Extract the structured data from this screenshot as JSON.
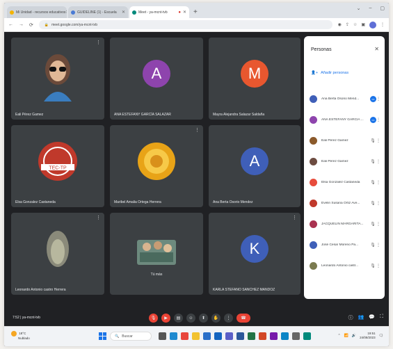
{
  "browser": {
    "tabs": [
      {
        "label": "Mi Unidad - recursos educativos",
        "active": false
      },
      {
        "label": "GUIDELINE (1) - Escuela",
        "active": false
      },
      {
        "label": "Meet - ya-mcnt-tvb",
        "active": true
      }
    ],
    "url": "meet.google.com/ya-mcnt-tvb"
  },
  "tiles": [
    {
      "name": "Eali Pérez Gamez",
      "kind": "photo",
      "photo": "woman-sunglasses"
    },
    {
      "name": "ANA ESTEFANY GARCÍA SALAZAR",
      "kind": "avatar",
      "letter": "A",
      "color": "#8e44ad"
    },
    {
      "name": "Mayra Alejandra Salazar Saldaña",
      "kind": "avatar",
      "letter": "M",
      "color": "#e8572f"
    },
    {
      "name": "Elsa Gonzalez Castaneda",
      "kind": "photo",
      "photo": "tec-logo"
    },
    {
      "name": "Maribel Amalia Ortega Herrera",
      "kind": "photo",
      "photo": "yellow-flower"
    },
    {
      "name": "Ana Berta Osorio Mendez",
      "kind": "avatar",
      "letter": "A",
      "color": "#3f5fb8"
    },
    {
      "name": "Leonardo Antonio castro Herrera",
      "kind": "photo",
      "photo": "plant"
    },
    {
      "name": "Tú más",
      "kind": "photo",
      "photo": "group"
    },
    {
      "name": "KARLA STEFANO SANCHEZ MANDOZ",
      "kind": "avatar",
      "letter": "K",
      "color": "#3f5fb8"
    }
  ],
  "panel": {
    "title": "Personas",
    "close_icon": "close-icon",
    "add_people_label": "Añadir personas",
    "people": [
      {
        "name": "Ana Berta Osorio Mend...",
        "avatar_color": "#3f5fb8",
        "speaking": true
      },
      {
        "name": "ANA ESTEFANY GARCÍA ...",
        "avatar_color": "#8e44ad",
        "speaking": true
      },
      {
        "name": "Eali Pérez Gamez",
        "avatar_color": "#8b5a2b",
        "speaking": false
      },
      {
        "name": "Eali Pérez Gamez",
        "avatar_color": "#6d4c41",
        "speaking": false
      },
      {
        "name": "Elsa Gonzalez Castaneda",
        "avatar_color": "#e74c3c",
        "speaking": false
      },
      {
        "name": "Evelin Susana Ortiz Ave...",
        "avatar_color": "#c0392b",
        "speaking": false
      },
      {
        "name": "JACQUELIN MARGARITA...",
        "avatar_color": "#a93250",
        "speaking": false
      },
      {
        "name": "José Cesar Moreno Pa...",
        "avatar_color": "#3f5fb8",
        "speaking": false
      },
      {
        "name": "Leonardo Antonio castr...",
        "avatar_color": "#7a7a4f",
        "speaking": false
      }
    ]
  },
  "controls": {
    "meeting_info": "7:52 | ya-mcnt-tvb"
  },
  "taskbar": {
    "weather_temp": "18°C",
    "weather_desc": "Nublado",
    "search_placeholder": "Buscar",
    "time": "19:51",
    "date": "24/08/2023"
  }
}
